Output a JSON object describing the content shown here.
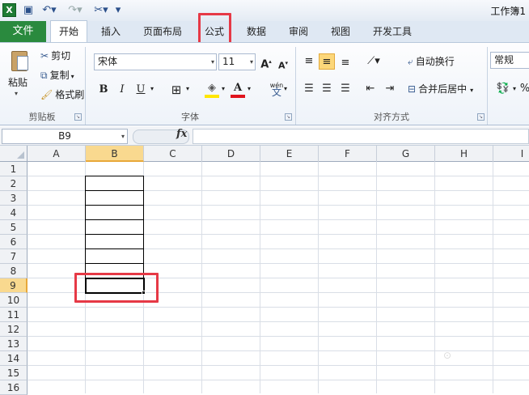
{
  "app": {
    "logo": "X",
    "title": "工作簿1"
  },
  "quick_access": [
    {
      "name": "save-icon",
      "glyph": "💾"
    },
    {
      "name": "undo-icon",
      "glyph": "↶▾"
    },
    {
      "name": "redo-icon",
      "glyph": "↷▾"
    },
    {
      "name": "tools-icon",
      "glyph": "✂▾"
    },
    {
      "name": "customize-icon",
      "glyph": "⫽"
    }
  ],
  "tabs": {
    "file": "文件",
    "home": "开始",
    "insert": "插入",
    "page_layout": "页面布局",
    "formulas": "公式",
    "data": "数据",
    "review": "审阅",
    "view": "视图",
    "developer": "开发工具"
  },
  "clipboard": {
    "paste": "粘贴",
    "cut": "剪切",
    "copy": "复制",
    "format_painter": "格式刷",
    "group": "剪贴板"
  },
  "font": {
    "name": "宋体",
    "size": "11",
    "bold": "B",
    "italic": "I",
    "underline": "U",
    "grow": "A",
    "shrink": "A",
    "font_color": "A",
    "phonetic": "wén",
    "group": "字体"
  },
  "alignment": {
    "wrap": "自动换行",
    "merge": "合并后居中",
    "group": "对齐方式"
  },
  "number": {
    "format": "常规",
    "percent": "%"
  },
  "formula_bar": {
    "name_box": "B9",
    "fx": "fx",
    "value": ""
  },
  "columns": [
    "A",
    "B",
    "C",
    "D",
    "E",
    "F",
    "G",
    "H",
    "I"
  ],
  "rows": [
    "1",
    "2",
    "3",
    "4",
    "5",
    "6",
    "7",
    "8",
    "9",
    "10",
    "11",
    "12",
    "13",
    "14",
    "15",
    "16"
  ],
  "selected_cell": "B9",
  "highlight_color": "#e63946",
  "accent_color": "#2a8a3e"
}
